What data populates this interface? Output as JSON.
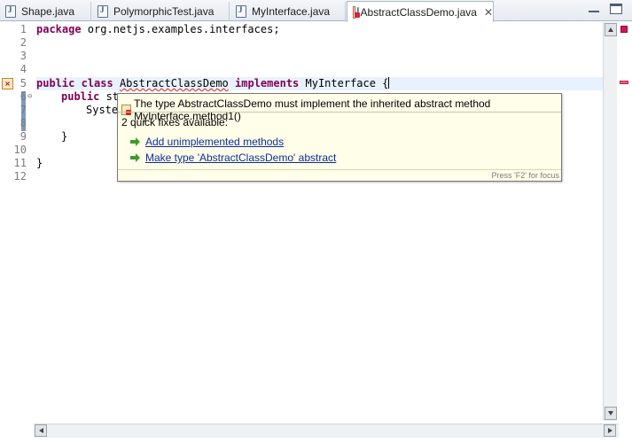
{
  "tabs": [
    {
      "label": "Shape.java",
      "active": false
    },
    {
      "label": "PolymorphicTest.java",
      "active": false
    },
    {
      "label": "MyInterface.java",
      "active": false
    },
    {
      "label": "AbstractClassDemo.java",
      "active": true
    }
  ],
  "tab_close_glyph": "✕",
  "editor": {
    "line_numbers": [
      "1",
      "2",
      "3",
      "4",
      "5",
      "6",
      "7",
      "8",
      "9",
      "10",
      "11",
      "12"
    ],
    "fold_markers": {
      "line6": "⊖"
    },
    "lines": {
      "l1_kw": "package",
      "l1_rest": " org.netjs.examples.interfaces;",
      "l5_kw1": "public",
      "l5_kw2": "class",
      "l5_name": "AbstractClassDemo",
      "l5_kw3": "implements",
      "l5_rest": " MyInterface {",
      "l6_kw1": "public",
      "l6_partial": " st",
      "l7_partial": "Syste",
      "l10_text": "}",
      "l11_text": "}"
    }
  },
  "popup": {
    "message": "The type AbstractClassDemo must implement the inherited abstract method MyInterface.method1()",
    "quick_fix_count": "2 quick fixes available:",
    "fixes": [
      "Add unimplemented methods",
      "Make type 'AbstractClassDemo' abstract"
    ],
    "footer": "Press 'F2' for focus"
  },
  "colors": {
    "keyword": "#7f0055",
    "current_line": "#e8f2fe",
    "popup_bg": "#fffee8",
    "link": "#0b2da0",
    "error": "#e02020"
  }
}
